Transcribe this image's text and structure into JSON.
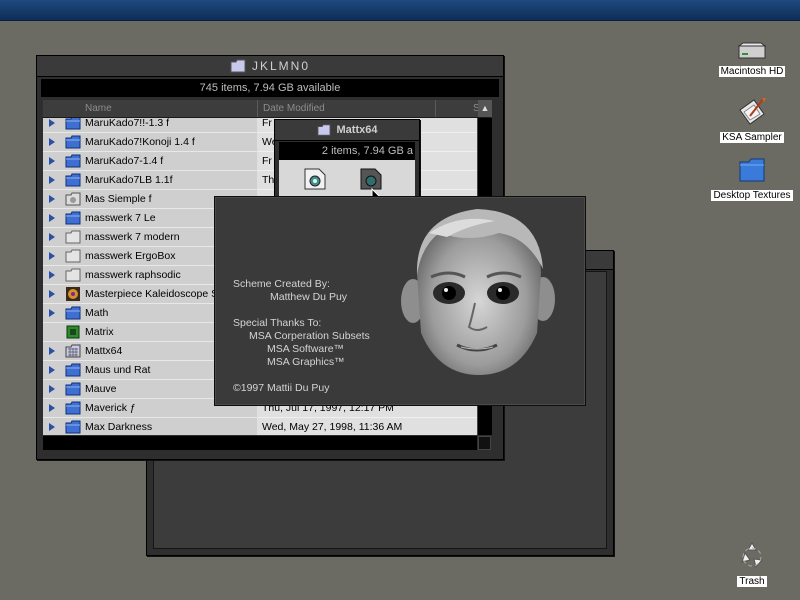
{
  "main_window": {
    "title": "JKLMN0",
    "status": "745 items, 7.94 GB available",
    "columns": {
      "name": "Name",
      "date": "Date Modified",
      "size": "S"
    },
    "rows": [
      {
        "name": "MaruKado7!!-1.3 f",
        "date": "Fr",
        "icon": "folder-blue-icon",
        "expandable": true
      },
      {
        "name": "MaruKado7!Konoji 1.4 f",
        "date": "We",
        "icon": "folder-blue-icon",
        "expandable": true
      },
      {
        "name": "MaruKado7-1.4 f",
        "date": "Fr",
        "icon": "folder-blue-icon",
        "expandable": true
      },
      {
        "name": "MaruKado7LB 1.1f",
        "date": "Th",
        "icon": "folder-blue-icon",
        "expandable": true
      },
      {
        "name": "Mas Siemple f",
        "date": "",
        "icon": "folder-disk-icon",
        "expandable": true
      },
      {
        "name": "masswerk 7 Le",
        "date": "",
        "icon": "folder-blue-icon",
        "expandable": true
      },
      {
        "name": "masswerk 7 modern",
        "date": "",
        "icon": "folder-gray-icon",
        "expandable": true
      },
      {
        "name": "masswerk ErgoBox",
        "date": "",
        "icon": "folder-gray-icon",
        "expandable": true
      },
      {
        "name": "masswerk raphsodic",
        "date": "",
        "icon": "folder-gray-icon",
        "expandable": true
      },
      {
        "name": "Masterpiece Kaleidoscope S",
        "date": "",
        "icon": "kaleidoscope-icon",
        "expandable": true
      },
      {
        "name": "Math",
        "date": "",
        "icon": "folder-blue-icon",
        "expandable": true
      },
      {
        "name": "Matrix",
        "date": "",
        "icon": "matrix-app-icon",
        "expandable": false
      },
      {
        "name": "Mattx64",
        "date": "",
        "icon": "folder-checker-icon",
        "expandable": true
      },
      {
        "name": "Maus und Rat",
        "date": "",
        "icon": "folder-blue-icon",
        "expandable": true
      },
      {
        "name": "Mauve",
        "date": "",
        "icon": "folder-blue-icon",
        "expandable": true
      },
      {
        "name": "Maverick ƒ",
        "date": "Thu, Jul 17, 1997, 12:17 PM",
        "icon": "folder-blue-icon",
        "expandable": true
      },
      {
        "name": "Max Darkness",
        "date": "Wed, May 27, 1998, 11:36 AM",
        "icon": "folder-blue-icon",
        "expandable": true
      }
    ]
  },
  "mattx_window": {
    "title": "Mattx64",
    "status": "2 items, 7.94 GB a"
  },
  "about_panel": {
    "credit_heading": "Scheme Created By:",
    "credit_name": "Matthew Du Puy",
    "thanks_heading": "Special Thanks To:",
    "thanks": [
      "MSA Corperation Subsets",
      "MSA Software™",
      "MSA Graphics™"
    ],
    "copyright": "©1997 Mattii Du Puy"
  },
  "desktop_icons": [
    {
      "label": "Macintosh HD",
      "icon": "hard-drive-icon"
    },
    {
      "label": "KSA Sampler",
      "icon": "sampler-app-icon"
    },
    {
      "label": "Desktop Textures",
      "icon": "folder-blue-icon"
    },
    {
      "label": "Trash",
      "icon": "trash-icon"
    }
  ]
}
